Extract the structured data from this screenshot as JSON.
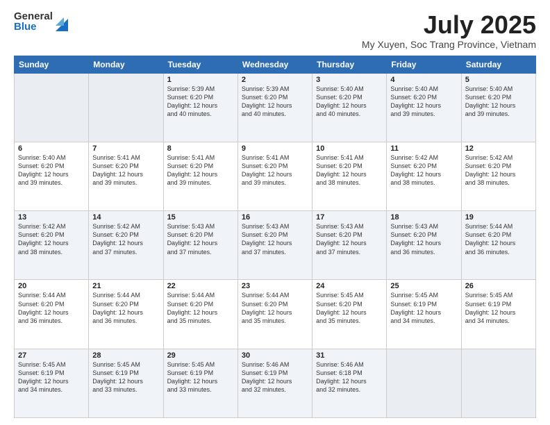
{
  "logo": {
    "general": "General",
    "blue": "Blue"
  },
  "title": {
    "month": "July 2025",
    "location": "My Xuyen, Soc Trang Province, Vietnam"
  },
  "days_of_week": [
    "Sunday",
    "Monday",
    "Tuesday",
    "Wednesday",
    "Thursday",
    "Friday",
    "Saturday"
  ],
  "weeks": [
    [
      {
        "day": "",
        "info": ""
      },
      {
        "day": "",
        "info": ""
      },
      {
        "day": "1",
        "info": "Sunrise: 5:39 AM\nSunset: 6:20 PM\nDaylight: 12 hours\nand 40 minutes."
      },
      {
        "day": "2",
        "info": "Sunrise: 5:39 AM\nSunset: 6:20 PM\nDaylight: 12 hours\nand 40 minutes."
      },
      {
        "day": "3",
        "info": "Sunrise: 5:40 AM\nSunset: 6:20 PM\nDaylight: 12 hours\nand 40 minutes."
      },
      {
        "day": "4",
        "info": "Sunrise: 5:40 AM\nSunset: 6:20 PM\nDaylight: 12 hours\nand 39 minutes."
      },
      {
        "day": "5",
        "info": "Sunrise: 5:40 AM\nSunset: 6:20 PM\nDaylight: 12 hours\nand 39 minutes."
      }
    ],
    [
      {
        "day": "6",
        "info": "Sunrise: 5:40 AM\nSunset: 6:20 PM\nDaylight: 12 hours\nand 39 minutes."
      },
      {
        "day": "7",
        "info": "Sunrise: 5:41 AM\nSunset: 6:20 PM\nDaylight: 12 hours\nand 39 minutes."
      },
      {
        "day": "8",
        "info": "Sunrise: 5:41 AM\nSunset: 6:20 PM\nDaylight: 12 hours\nand 39 minutes."
      },
      {
        "day": "9",
        "info": "Sunrise: 5:41 AM\nSunset: 6:20 PM\nDaylight: 12 hours\nand 39 minutes."
      },
      {
        "day": "10",
        "info": "Sunrise: 5:41 AM\nSunset: 6:20 PM\nDaylight: 12 hours\nand 38 minutes."
      },
      {
        "day": "11",
        "info": "Sunrise: 5:42 AM\nSunset: 6:20 PM\nDaylight: 12 hours\nand 38 minutes."
      },
      {
        "day": "12",
        "info": "Sunrise: 5:42 AM\nSunset: 6:20 PM\nDaylight: 12 hours\nand 38 minutes."
      }
    ],
    [
      {
        "day": "13",
        "info": "Sunrise: 5:42 AM\nSunset: 6:20 PM\nDaylight: 12 hours\nand 38 minutes."
      },
      {
        "day": "14",
        "info": "Sunrise: 5:42 AM\nSunset: 6:20 PM\nDaylight: 12 hours\nand 37 minutes."
      },
      {
        "day": "15",
        "info": "Sunrise: 5:43 AM\nSunset: 6:20 PM\nDaylight: 12 hours\nand 37 minutes."
      },
      {
        "day": "16",
        "info": "Sunrise: 5:43 AM\nSunset: 6:20 PM\nDaylight: 12 hours\nand 37 minutes."
      },
      {
        "day": "17",
        "info": "Sunrise: 5:43 AM\nSunset: 6:20 PM\nDaylight: 12 hours\nand 37 minutes."
      },
      {
        "day": "18",
        "info": "Sunrise: 5:43 AM\nSunset: 6:20 PM\nDaylight: 12 hours\nand 36 minutes."
      },
      {
        "day": "19",
        "info": "Sunrise: 5:44 AM\nSunset: 6:20 PM\nDaylight: 12 hours\nand 36 minutes."
      }
    ],
    [
      {
        "day": "20",
        "info": "Sunrise: 5:44 AM\nSunset: 6:20 PM\nDaylight: 12 hours\nand 36 minutes."
      },
      {
        "day": "21",
        "info": "Sunrise: 5:44 AM\nSunset: 6:20 PM\nDaylight: 12 hours\nand 36 minutes."
      },
      {
        "day": "22",
        "info": "Sunrise: 5:44 AM\nSunset: 6:20 PM\nDaylight: 12 hours\nand 35 minutes."
      },
      {
        "day": "23",
        "info": "Sunrise: 5:44 AM\nSunset: 6:20 PM\nDaylight: 12 hours\nand 35 minutes."
      },
      {
        "day": "24",
        "info": "Sunrise: 5:45 AM\nSunset: 6:20 PM\nDaylight: 12 hours\nand 35 minutes."
      },
      {
        "day": "25",
        "info": "Sunrise: 5:45 AM\nSunset: 6:19 PM\nDaylight: 12 hours\nand 34 minutes."
      },
      {
        "day": "26",
        "info": "Sunrise: 5:45 AM\nSunset: 6:19 PM\nDaylight: 12 hours\nand 34 minutes."
      }
    ],
    [
      {
        "day": "27",
        "info": "Sunrise: 5:45 AM\nSunset: 6:19 PM\nDaylight: 12 hours\nand 34 minutes."
      },
      {
        "day": "28",
        "info": "Sunrise: 5:45 AM\nSunset: 6:19 PM\nDaylight: 12 hours\nand 33 minutes."
      },
      {
        "day": "29",
        "info": "Sunrise: 5:45 AM\nSunset: 6:19 PM\nDaylight: 12 hours\nand 33 minutes."
      },
      {
        "day": "30",
        "info": "Sunrise: 5:46 AM\nSunset: 6:19 PM\nDaylight: 12 hours\nand 32 minutes."
      },
      {
        "day": "31",
        "info": "Sunrise: 5:46 AM\nSunset: 6:18 PM\nDaylight: 12 hours\nand 32 minutes."
      },
      {
        "day": "",
        "info": ""
      },
      {
        "day": "",
        "info": ""
      }
    ]
  ]
}
